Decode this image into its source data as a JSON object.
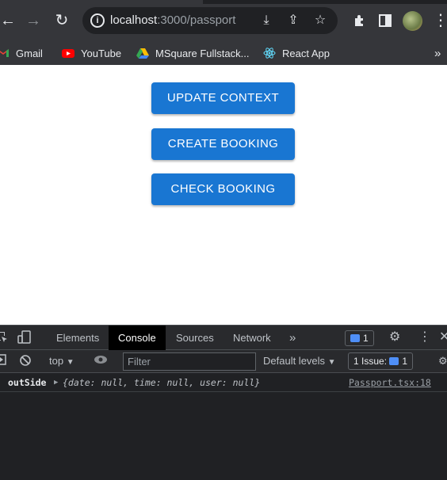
{
  "browser": {
    "url_host": "localhost",
    "url_path": ":3000/passport",
    "bookmarks": [
      {
        "label": "Gmail",
        "icon": "gmail-icon"
      },
      {
        "label": "YouTube",
        "icon": "youtube-icon"
      },
      {
        "label": "MSquare Fullstack...",
        "icon": "google-drive-icon"
      },
      {
        "label": "React App",
        "icon": "react-icon"
      }
    ],
    "more_bookmarks": "»"
  },
  "page": {
    "buttons": {
      "update_context": "UPDATE CONTEXT",
      "create_booking": "CREATE BOOKING",
      "check_booking": "CHECK BOOKING"
    },
    "button_color": "#1976d2"
  },
  "devtools": {
    "tabs": {
      "elements": "Elements",
      "console": "Console",
      "sources": "Sources",
      "network": "Network",
      "more": "»"
    },
    "messages_count": "1",
    "console_toolbar": {
      "context": "top",
      "filter_placeholder": "Filter",
      "levels": "Default levels",
      "issues_label": "1 Issue:",
      "issues_count": "1"
    },
    "log": {
      "label": "outSide",
      "object": "{date: null, time: null, user: null}",
      "source": "Passport.tsx:18"
    }
  }
}
